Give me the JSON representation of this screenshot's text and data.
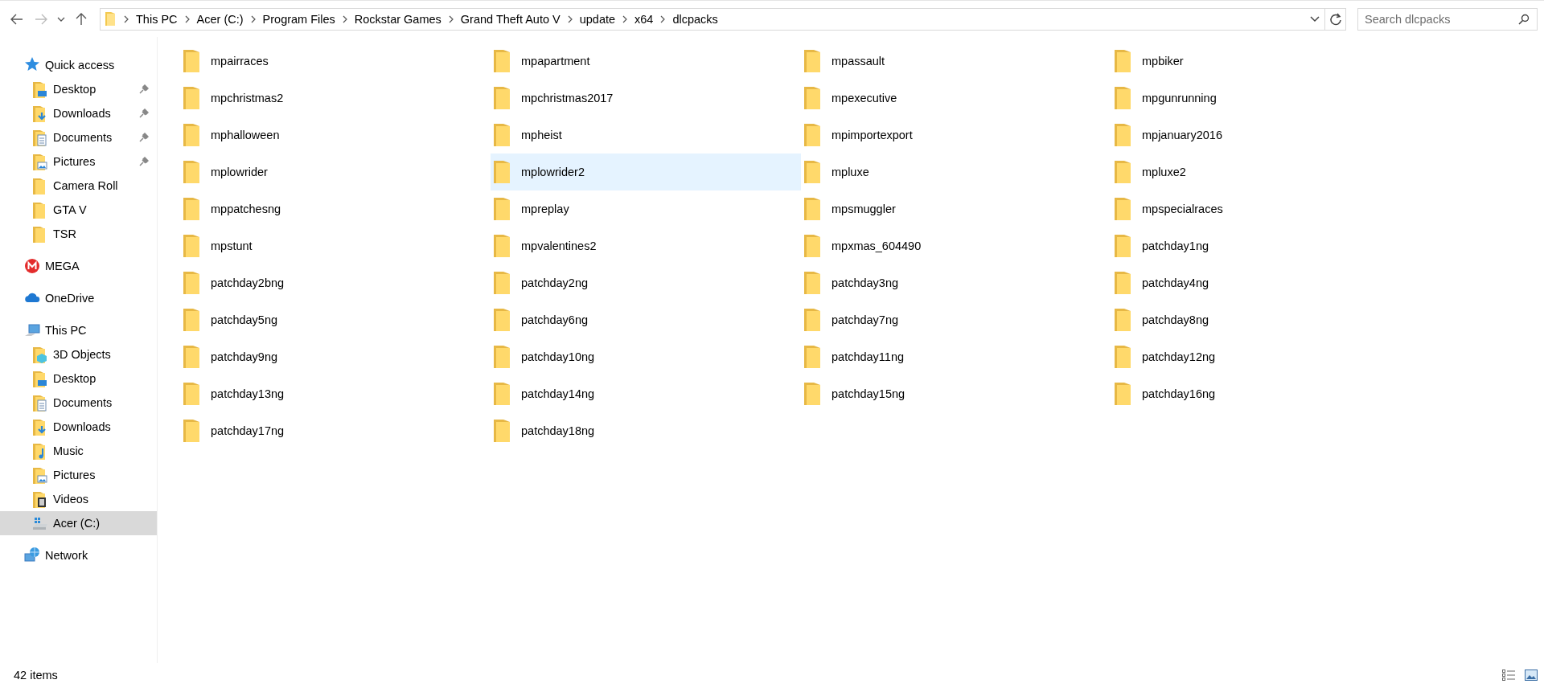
{
  "address_bar": {
    "crumbs": [
      "This PC",
      "Acer (C:)",
      "Program Files",
      "Rockstar Games",
      "Grand Theft Auto V",
      "update",
      "x64",
      "dlcpacks"
    ]
  },
  "search": {
    "placeholder": "Search dlcpacks"
  },
  "sidebar": {
    "items": [
      {
        "label": "Quick access",
        "kind": "star",
        "selected": false,
        "children": [
          {
            "label": "Desktop",
            "kind": "desktop",
            "selected": false,
            "pinned": true
          },
          {
            "label": "Downloads",
            "kind": "downloads",
            "selected": false,
            "pinned": true
          },
          {
            "label": "Documents",
            "kind": "documents",
            "selected": false,
            "pinned": true
          },
          {
            "label": "Pictures",
            "kind": "pictures",
            "selected": false,
            "pinned": true
          },
          {
            "label": "Camera Roll",
            "kind": "folder",
            "selected": false,
            "pinned": false
          },
          {
            "label": "GTA V",
            "kind": "folder",
            "selected": false,
            "pinned": false
          },
          {
            "label": "TSR",
            "kind": "folder",
            "selected": false,
            "pinned": false
          }
        ]
      },
      {
        "label": "MEGA",
        "kind": "mega",
        "selected": false
      },
      {
        "label": "OneDrive",
        "kind": "cloud",
        "selected": false
      },
      {
        "label": "This PC",
        "kind": "pc",
        "selected": false,
        "children": [
          {
            "label": "3D Objects",
            "kind": "objects",
            "selected": false
          },
          {
            "label": "Desktop",
            "kind": "desktop",
            "selected": false
          },
          {
            "label": "Documents",
            "kind": "documents",
            "selected": false
          },
          {
            "label": "Downloads",
            "kind": "downloads",
            "selected": false
          },
          {
            "label": "Music",
            "kind": "music",
            "selected": false
          },
          {
            "label": "Pictures",
            "kind": "pictures",
            "selected": false
          },
          {
            "label": "Videos",
            "kind": "videos",
            "selected": false
          },
          {
            "label": "Acer (C:)",
            "kind": "drive",
            "selected": true
          }
        ]
      },
      {
        "label": "Network",
        "kind": "network",
        "selected": false
      }
    ]
  },
  "files": [
    {
      "name": "mpairraces",
      "selected": false
    },
    {
      "name": "mpapartment",
      "selected": false
    },
    {
      "name": "mpassault",
      "selected": false
    },
    {
      "name": "mpbiker",
      "selected": false
    },
    {
      "name": "mpchristmas2",
      "selected": false
    },
    {
      "name": "mpchristmas2017",
      "selected": false
    },
    {
      "name": "mpexecutive",
      "selected": false
    },
    {
      "name": "mpgunrunning",
      "selected": false
    },
    {
      "name": "mphalloween",
      "selected": false
    },
    {
      "name": "mpheist",
      "selected": false
    },
    {
      "name": "mpimportexport",
      "selected": false
    },
    {
      "name": "mpjanuary2016",
      "selected": false
    },
    {
      "name": "mplowrider",
      "selected": false
    },
    {
      "name": "mplowrider2",
      "selected": true
    },
    {
      "name": "mpluxe",
      "selected": false
    },
    {
      "name": "mpluxe2",
      "selected": false
    },
    {
      "name": "mppatchesng",
      "selected": false
    },
    {
      "name": "mpreplay",
      "selected": false
    },
    {
      "name": "mpsmuggler",
      "selected": false
    },
    {
      "name": "mpspecialraces",
      "selected": false
    },
    {
      "name": "mpstunt",
      "selected": false
    },
    {
      "name": "mpvalentines2",
      "selected": false
    },
    {
      "name": "mpxmas_604490",
      "selected": false
    },
    {
      "name": "patchday1ng",
      "selected": false
    },
    {
      "name": "patchday2bng",
      "selected": false
    },
    {
      "name": "patchday2ng",
      "selected": false
    },
    {
      "name": "patchday3ng",
      "selected": false
    },
    {
      "name": "patchday4ng",
      "selected": false
    },
    {
      "name": "patchday5ng",
      "selected": false
    },
    {
      "name": "patchday6ng",
      "selected": false
    },
    {
      "name": "patchday7ng",
      "selected": false
    },
    {
      "name": "patchday8ng",
      "selected": false
    },
    {
      "name": "patchday9ng",
      "selected": false
    },
    {
      "name": "patchday10ng",
      "selected": false
    },
    {
      "name": "patchday11ng",
      "selected": false
    },
    {
      "name": "patchday12ng",
      "selected": false
    },
    {
      "name": "patchday13ng",
      "selected": false
    },
    {
      "name": "patchday14ng",
      "selected": false
    },
    {
      "name": "patchday15ng",
      "selected": false
    },
    {
      "name": "patchday16ng",
      "selected": false
    },
    {
      "name": "patchday17ng",
      "selected": false
    },
    {
      "name": "patchday18ng",
      "selected": false
    }
  ],
  "status_bar": {
    "count": "42 items"
  }
}
